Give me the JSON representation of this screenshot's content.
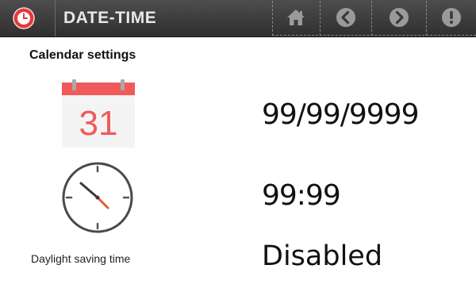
{
  "header": {
    "title": "DATE-TIME",
    "app_icon": "clock-badge-icon",
    "nav": [
      {
        "name": "home",
        "icon": "home-icon"
      },
      {
        "name": "back",
        "icon": "back-arrow-icon"
      },
      {
        "name": "forward",
        "icon": "forward-arrow-icon"
      },
      {
        "name": "info",
        "icon": "info-icon"
      }
    ],
    "colors": {
      "bar": "#3a3a3a",
      "icon": "#9a9a9a",
      "app_icon_red": "#e03a3e"
    }
  },
  "main": {
    "section_title": "Calendar settings",
    "calendar": {
      "icon": "calendar-icon",
      "day": "31",
      "value": "99/99/9999",
      "color": "#f05a5a"
    },
    "clock": {
      "icon": "clock-icon",
      "value": "99:99",
      "hand_color": "#e0602c"
    },
    "daylight_saving": {
      "label": "Daylight saving time",
      "value": "Disabled"
    }
  }
}
